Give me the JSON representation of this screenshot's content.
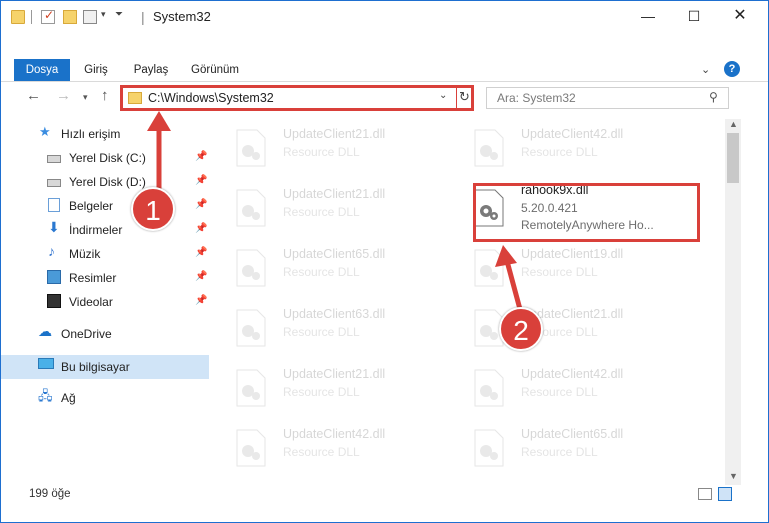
{
  "window": {
    "title": "System32",
    "controls": {
      "minimize": "—",
      "maximize": "☐",
      "close": "✕"
    }
  },
  "ribbon": {
    "tabs": [
      "Dosya",
      "Giriş",
      "Paylaş",
      "Görünüm"
    ],
    "help": "?"
  },
  "nav": {
    "address": "C:\\Windows\\System32",
    "search_placeholder": "Ara: System32"
  },
  "sidebar": {
    "items": [
      {
        "label": "Hızlı erişim",
        "icon": "star-icon"
      },
      {
        "label": "Yerel Disk (C:)",
        "icon": "disk-icon",
        "pinned": true
      },
      {
        "label": "Yerel Disk (D:)",
        "icon": "disk-icon",
        "pinned": true
      },
      {
        "label": "Belgeler",
        "icon": "documents-icon",
        "pinned": true
      },
      {
        "label": "İndirmeler",
        "icon": "downloads-icon",
        "pinned": true
      },
      {
        "label": "Müzik",
        "icon": "music-icon",
        "pinned": true
      },
      {
        "label": "Resimler",
        "icon": "pictures-icon",
        "pinned": true
      },
      {
        "label": "Videolar",
        "icon": "videos-icon",
        "pinned": true
      },
      {
        "label": "OneDrive",
        "icon": "cloud-icon"
      },
      {
        "label": "Bu bilgisayar",
        "icon": "computer-icon",
        "selected": true
      },
      {
        "label": "Ağ",
        "icon": "network-icon"
      }
    ]
  },
  "files": {
    "left_column": [
      {
        "name": "UpdateClient21.dll",
        "type": "Resource DLL"
      },
      {
        "name": "UpdateClient21.dll",
        "type": "Resource DLL"
      },
      {
        "name": "UpdateClient65.dll",
        "type": "Resource DLL"
      },
      {
        "name": "UpdateClient63.dll",
        "type": "Resource DLL"
      },
      {
        "name": "UpdateClient21.dll",
        "type": "Resource DLL"
      },
      {
        "name": "UpdateClient42.dll",
        "type": "Resource DLL"
      }
    ],
    "right_column": [
      {
        "name": "UpdateClient42.dll",
        "type": "Resource DLL"
      },
      {
        "name": "rahook9x.dll",
        "version": "5.20.0.421",
        "type": "RemotelyAnywhere Ho...",
        "highlighted": true
      },
      {
        "name": "UpdateClient19.dll",
        "type": "Resource DLL"
      },
      {
        "name": "UpdateClient21.dll",
        "type": "Resource DLL"
      },
      {
        "name": "UpdateClient42.dll",
        "type": "Resource DLL"
      },
      {
        "name": "UpdateClient65.dll",
        "type": "Resource DLL"
      }
    ]
  },
  "status": {
    "item_count": "199 öğe"
  },
  "annotations": {
    "step1": "1",
    "step2": "2",
    "color": "#d9403a"
  }
}
